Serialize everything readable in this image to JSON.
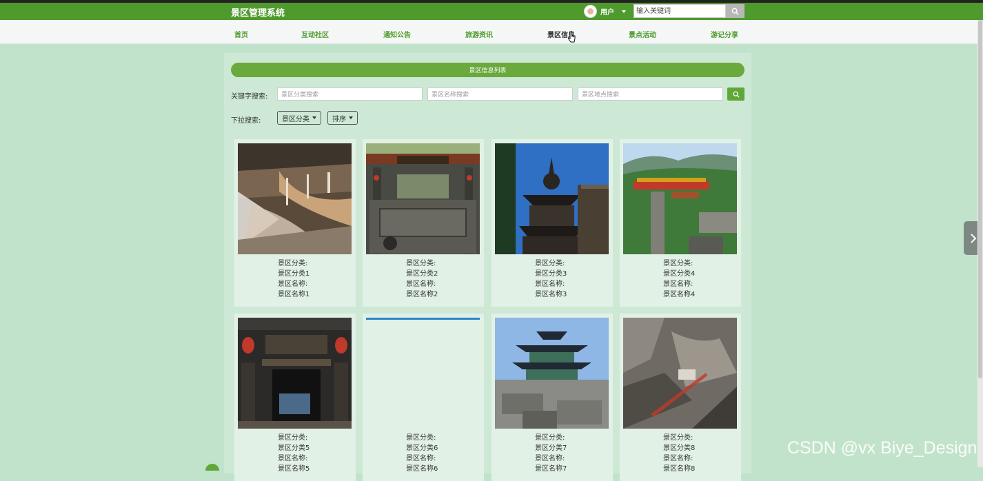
{
  "header": {
    "brand": "景区管理系统",
    "user_label": "用户",
    "search_placeholder": "输入关键词"
  },
  "nav": [
    {
      "label": "首页"
    },
    {
      "label": "互动社区"
    },
    {
      "label": "通知公告"
    },
    {
      "label": "旅游资讯"
    },
    {
      "label": "景区信息"
    },
    {
      "label": "景点活动"
    },
    {
      "label": "游记分享"
    }
  ],
  "list": {
    "title": "景区信息列表",
    "keyword_label": "关键字搜索:",
    "category_placeholder": "景区分类搜索",
    "name_placeholder": "景区名称搜索",
    "location_placeholder": "景区地点搜索",
    "dropdown_label": "下拉搜索:",
    "category_dropdown": "景区分类",
    "sort_dropdown": "排序"
  },
  "cards": [
    {
      "cat_label": "景区分类:",
      "cat": "景区分类1",
      "name_label": "景区名称:",
      "name": "景区名称1"
    },
    {
      "cat_label": "景区分类:",
      "cat": "景区分类2",
      "name_label": "景区名称:",
      "name": "景区名称2"
    },
    {
      "cat_label": "景区分类:",
      "cat": "景区分类3",
      "name_label": "景区名称:",
      "name": "景区名称3"
    },
    {
      "cat_label": "景区分类:",
      "cat": "景区分类4",
      "name_label": "景区名称:",
      "name": "景区名称4"
    },
    {
      "cat_label": "景区分类:",
      "cat": "景区分类5",
      "name_label": "景区名称:",
      "name": "景区名称5"
    },
    {
      "cat_label": "景区分类:",
      "cat": "景区分类6",
      "name_label": "景区名称:",
      "name": "景区名称6"
    },
    {
      "cat_label": "景区分类:",
      "cat": "景区分类7",
      "name_label": "景区名称:",
      "name": "景区名称7"
    },
    {
      "cat_label": "景区分类:",
      "cat": "景区分类8",
      "name_label": "景区名称:",
      "name": "景区名称8"
    }
  ],
  "watermark": "CSDN @vx Biye_Design",
  "colors": {
    "header": "#4f9a2c",
    "accent": "#6aa93c",
    "page_bg": "#c2e3cb"
  },
  "icons": {
    "search": "search-icon",
    "next": "chevron-right-icon",
    "caret": "caret-down-icon"
  }
}
